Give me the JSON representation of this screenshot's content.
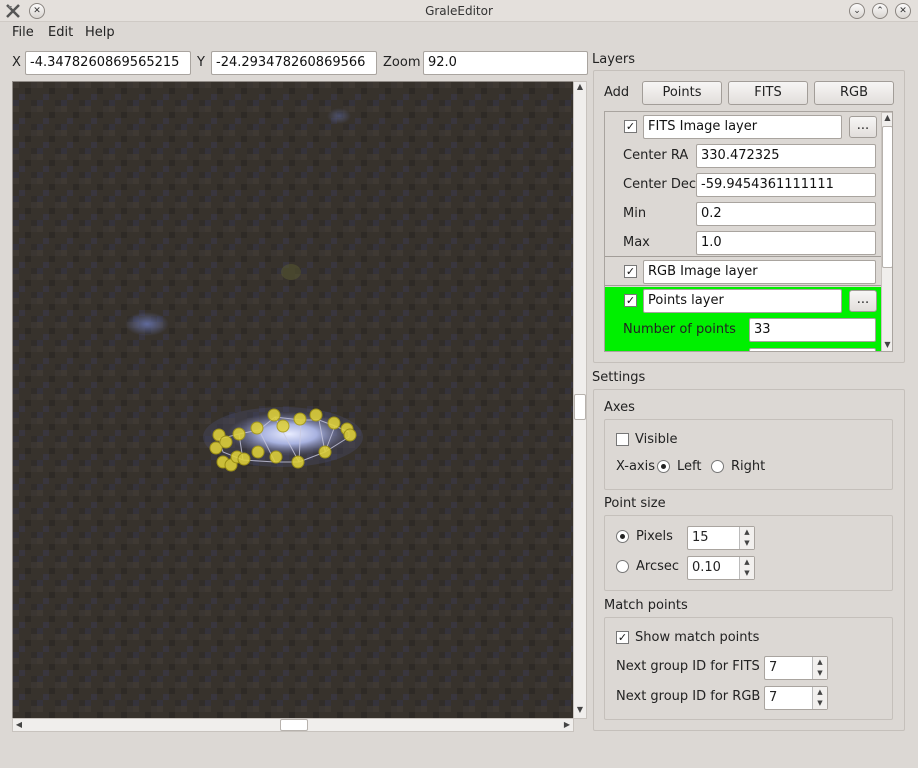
{
  "window": {
    "title": "GraleEditor"
  },
  "menu": {
    "file": "File",
    "edit": "Edit",
    "help": "Help"
  },
  "coords": {
    "x_label": "X",
    "x_value": "-4.3478260869565215",
    "y_label": "Y",
    "y_value": "-24.293478260869566",
    "zoom_label": "Zoom",
    "zoom_value": "92.0"
  },
  "layers": {
    "title": "Layers",
    "add_label": "Add",
    "add_points": "Points",
    "add_fits": "FITS",
    "add_rgb": "RGB",
    "fits_layer": {
      "name": "FITS Image layer",
      "center_ra_label": "Center RA",
      "center_ra": "330.472325",
      "center_dec_label": "Center Dec",
      "center_dec": "-59.9454361111111",
      "min_label": "Min",
      "min": "0.2",
      "max_label": "Max",
      "max": "1.0",
      "more": "..."
    },
    "rgb_layer": {
      "name": "RGB Image layer"
    },
    "points_layer": {
      "name": "Points layer",
      "num_points_label": "Number of points",
      "num_points": "33",
      "more": "...",
      "highlight_color": "#00f000"
    }
  },
  "settings": {
    "title": "Settings",
    "axes": {
      "title": "Axes",
      "visible_label": "Visible",
      "xaxis_label": "X-axis",
      "left": "Left",
      "right": "Right"
    },
    "point_size": {
      "title": "Point size",
      "pixels_label": "Pixels",
      "pixels_value": "15",
      "arcsec_label": "Arcsec",
      "arcsec_value": "0.10"
    },
    "match_points": {
      "title": "Match points",
      "show_label": "Show match points",
      "fits_label": "Next group ID for FITS",
      "fits_value": "7",
      "rgb_label": "Next group ID for RGB",
      "rgb_value": "7"
    }
  },
  "icons": {
    "app": "app-logo-icon",
    "close": "close-icon",
    "minimize": "minimize-icon",
    "maximize": "maximize-icon"
  }
}
